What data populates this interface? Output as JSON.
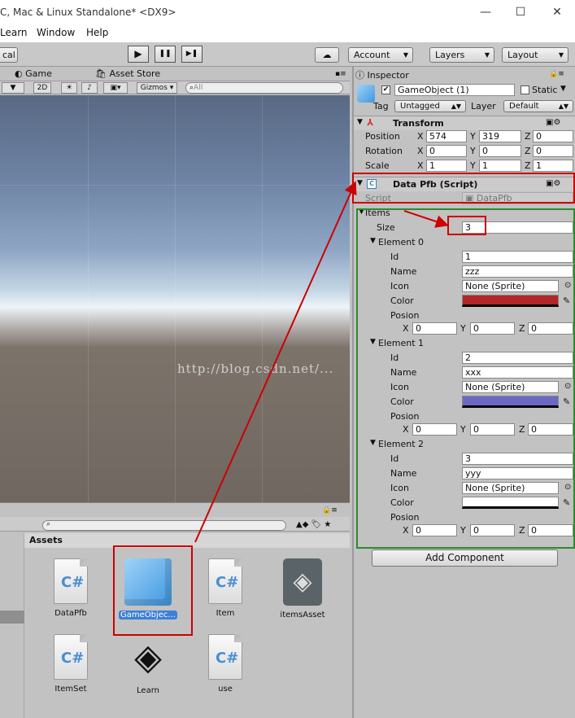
{
  "window": {
    "title": "C, Mac & Linux Standalone* <DX9>",
    "min": "—",
    "max": "☐",
    "close": "✕"
  },
  "menu": [
    "Learn",
    "Window",
    "Help"
  ],
  "toolbar": {
    "left_label": "cal",
    "account": "Account",
    "layers": "Layers",
    "layout": "Layout",
    "play": "▶",
    "pause": "❚❚",
    "step": "▶❚"
  },
  "tabs": {
    "game": "Game",
    "asset_store": "Asset Store",
    "inspector": "Inspector"
  },
  "scene_tools": {
    "mode": "2D",
    "gizmos": "Gizmos",
    "search_placeholder": "All"
  },
  "project": {
    "header": "Assets",
    "search_placeholder": "",
    "items": [
      {
        "label": "DataPfb",
        "type": "cs-script"
      },
      {
        "label": "GameObjec...",
        "type": "prefab",
        "selected": true
      },
      {
        "label": "Item",
        "type": "cs-script"
      },
      {
        "label": "itemsAsset",
        "type": "unity-asset"
      },
      {
        "label": "ItemSet",
        "type": "cs-script"
      },
      {
        "label": "Learn",
        "type": "unity-scene"
      },
      {
        "label": "use",
        "type": "cs-script"
      }
    ]
  },
  "inspector": {
    "name": "GameObject (1)",
    "static_label": "Static",
    "tag_label": "Tag",
    "tag_value": "Untagged",
    "layer_label": "Layer",
    "layer_value": "Default",
    "transform": {
      "title": "Transform",
      "position_label": "Position",
      "rotation_label": "Rotation",
      "scale_label": "Scale",
      "position": {
        "x": "574",
        "y": "319",
        "z": "0"
      },
      "rotation": {
        "x": "0",
        "y": "0",
        "z": "0"
      },
      "scale": {
        "x": "1",
        "y": "1",
        "z": "1"
      }
    },
    "script": {
      "title": "Data Pfb (Script)",
      "script_label": "Script",
      "script_value": "DataPfb",
      "items_label": "Items",
      "size_label": "Size",
      "size_value": "3",
      "id_label": "Id",
      "name_label": "Name",
      "icon_label": "Icon",
      "color_label": "Color",
      "posion_label": "Posion",
      "elements": [
        {
          "title": "Element 0",
          "id": "1",
          "name": "zzz",
          "icon": "None (Sprite)",
          "color": "#b22727",
          "pos": {
            "x": "0",
            "y": "0",
            "z": "0"
          }
        },
        {
          "title": "Element 1",
          "id": "2",
          "name": "xxx",
          "icon": "None (Sprite)",
          "color": "#6a6ac4",
          "pos": {
            "x": "0",
            "y": "0",
            "z": "0"
          }
        },
        {
          "title": "Element 2",
          "id": "3",
          "name": "yyy",
          "icon": "None (Sprite)",
          "color": "#ffffff",
          "pos": {
            "x": "0",
            "y": "0",
            "z": "0"
          }
        }
      ]
    },
    "add_component": "Add Component"
  },
  "watermark": "http://blog.csdn.net/..."
}
